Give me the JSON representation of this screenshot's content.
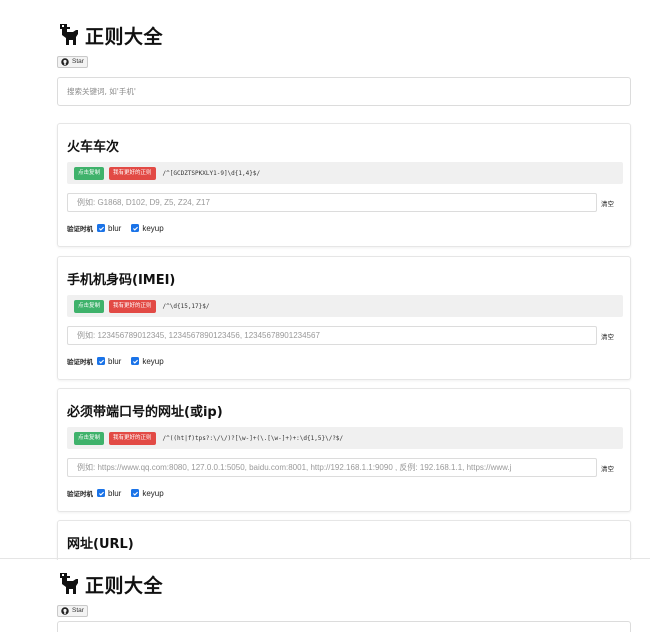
{
  "app": {
    "title": "正则大全",
    "star_label": "Star"
  },
  "search": {
    "placeholder": "搜索关键词, 如'手机'"
  },
  "common": {
    "copy_label": "点击复制",
    "better_label": "我有更好的正则",
    "clear_label": "清空",
    "verify_label": "验证时机",
    "blur_label": "blur",
    "keyup_label": "keyup"
  },
  "cards": [
    {
      "title": "火车车次",
      "regex": "/^[GCDZTSPKXLY1-9]\\d{1,4}$/",
      "example": "例如: G1868, D102, D9, Z5, Z24, Z17"
    },
    {
      "title": "手机机身码(IMEI)",
      "regex": "/^\\d{15,17}$/",
      "example": "例如: 123456789012345, 1234567890123456, 12345678901234567"
    },
    {
      "title": "必须带端口号的网址(或ip)",
      "regex": "/^((ht|f)tps?:\\/\\/)?[\\w-]+(\\.[\\w-]+)+:\\d{1,5}\\/?$/",
      "example": "例如: https://www.qq.com:8080, 127.0.0.1:5050, baidu.com:8001, http://192.168.1.1:9090 , 反例: 192.168.1.1, https://www.j"
    },
    {
      "title": "网址(URL)"
    }
  ],
  "colors": {
    "copy_button": "#3fb26b",
    "better_button": "#e24a45",
    "checkbox": "#1a73e8"
  }
}
